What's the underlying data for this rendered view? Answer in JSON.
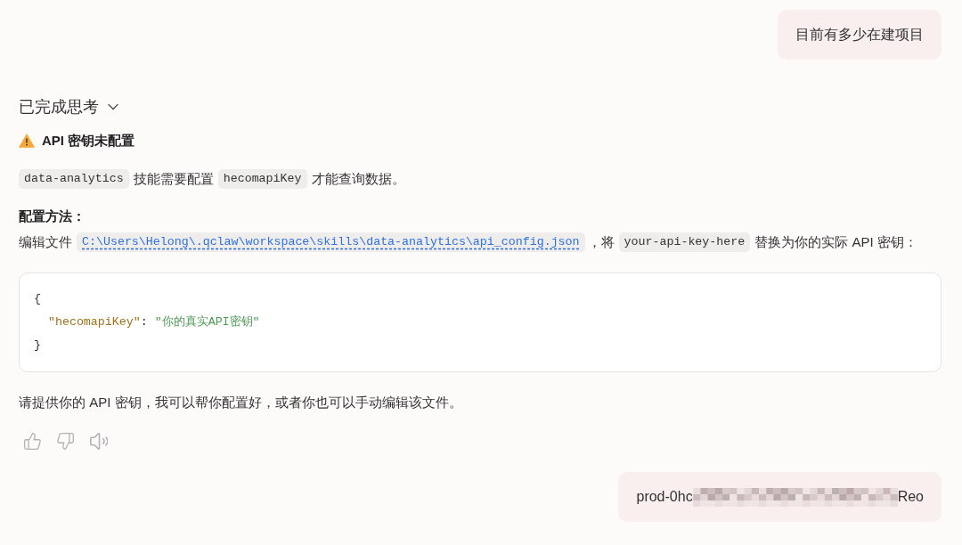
{
  "conversation": [
    {
      "kind": "user",
      "segments": [
        {
          "kind": "text",
          "text": "目前有多少在建项目"
        }
      ]
    },
    {
      "kind": "assistant",
      "thinking": {
        "label": "已完成思考",
        "expanded": false
      },
      "blocks": [
        {
          "kind": "warning_heading",
          "text": "API 密钥未配置"
        },
        {
          "kind": "paragraph",
          "segments": [
            {
              "kind": "code",
              "text": "data-analytics"
            },
            {
              "kind": "text",
              "text": "技能需要配置"
            },
            {
              "kind": "code",
              "text": "hecomapiKey"
            },
            {
              "kind": "text",
              "text": "才能查询数据。"
            }
          ]
        },
        {
          "kind": "subheading",
          "text": "配置方法："
        },
        {
          "kind": "paragraph",
          "segments": [
            {
              "kind": "text",
              "text": "编辑文件"
            },
            {
              "kind": "link",
              "text": "C:\\Users\\Helong\\.qclaw\\workspace\\skills\\data-analytics\\api_config.json"
            },
            {
              "kind": "text",
              "text": "，将"
            },
            {
              "kind": "code",
              "text": "your-api-key-here"
            },
            {
              "kind": "text",
              "text": "替换为你的实际 API 密钥："
            }
          ]
        },
        {
          "kind": "code_block",
          "lines": [
            {
              "tokens": [
                {
                  "kind": "punct",
                  "text": "{"
                }
              ]
            },
            {
              "tokens": [
                {
                  "kind": "key",
                  "text": "  \"hecomapiKey\""
                },
                {
                  "kind": "punct",
                  "text": ": "
                },
                {
                  "kind": "string",
                  "text": "\"你的真实API密钥\""
                }
              ]
            },
            {
              "tokens": [
                {
                  "kind": "punct",
                  "text": "}"
                }
              ]
            }
          ]
        },
        {
          "kind": "paragraph",
          "segments": [
            {
              "kind": "text",
              "text": "请提供你的 API 密钥，我可以帮你配置好，或者你也可以手动编辑该文件。"
            }
          ]
        }
      ]
    },
    {
      "kind": "user",
      "segments": [
        {
          "kind": "text",
          "text": "prod-0hc"
        },
        {
          "kind": "redacted"
        },
        {
          "kind": "text",
          "text": "Reo"
        }
      ]
    }
  ]
}
